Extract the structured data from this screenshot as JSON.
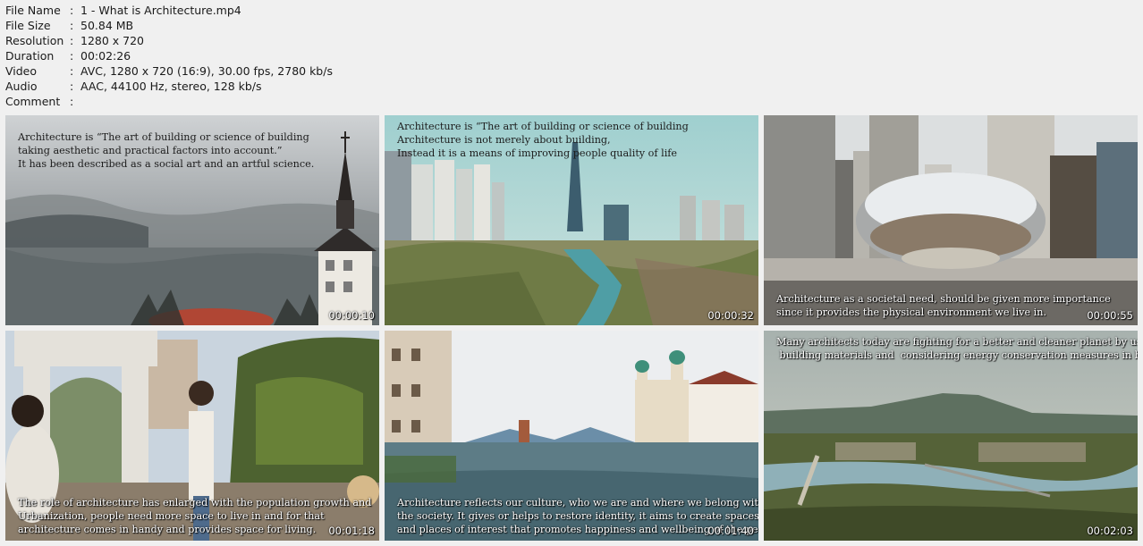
{
  "file_info": {
    "rows": [
      {
        "label": "File Name",
        "value": "1 - What is Architecture.mp4"
      },
      {
        "label": "File Size",
        "value": "50.84 MB"
      },
      {
        "label": "Resolution",
        "value": "1280 x 720"
      },
      {
        "label": "Duration",
        "value": "00:02:26"
      },
      {
        "label": "Video",
        "value": "AVC, 1280 x 720 (16:9), 30.00 fps, 2780 kb/s"
      },
      {
        "label": "Audio",
        "value": "AAC, 44100 Hz, stereo, 128 kb/s"
      },
      {
        "label": "Comment",
        "value": ""
      }
    ]
  },
  "thumbnails": [
    {
      "timestamp": "00:00:10",
      "caption": "Architecture is “The art of building or science of building\ntaking aesthetic and practical factors into account.”\nIt has been described as a social art and an artful science."
    },
    {
      "timestamp": "00:00:32",
      "caption": "Architecture is “The art of building or science of building\nArchitecture is not merely about building,\nInstead it is a means of improving people quality of life"
    },
    {
      "timestamp": "00:00:55",
      "caption": "Architecture as a societal need, should be given more importance\nsince it provides the physical environment we live in."
    },
    {
      "timestamp": "00:01:18",
      "caption": "The role of architecture has enlarged with the population growth and\nUrbanization, people need more space to live in and for that\narchitecture comes in handy and provides space for living."
    },
    {
      "timestamp": "00:01:40",
      "caption": "Architecture reflects our culture, who we are and where we belong within\nthe society. It gives or helps to restore identity, it aims to create spaces\nand places of interest that promotes happiness and wellbeing of the people."
    },
    {
      "timestamp": "00:02:03",
      "caption": "Many architects today are fighting for a better and cleaner planet by using sustainable\n building materials and  considering energy conservation measures in building design."
    }
  ]
}
